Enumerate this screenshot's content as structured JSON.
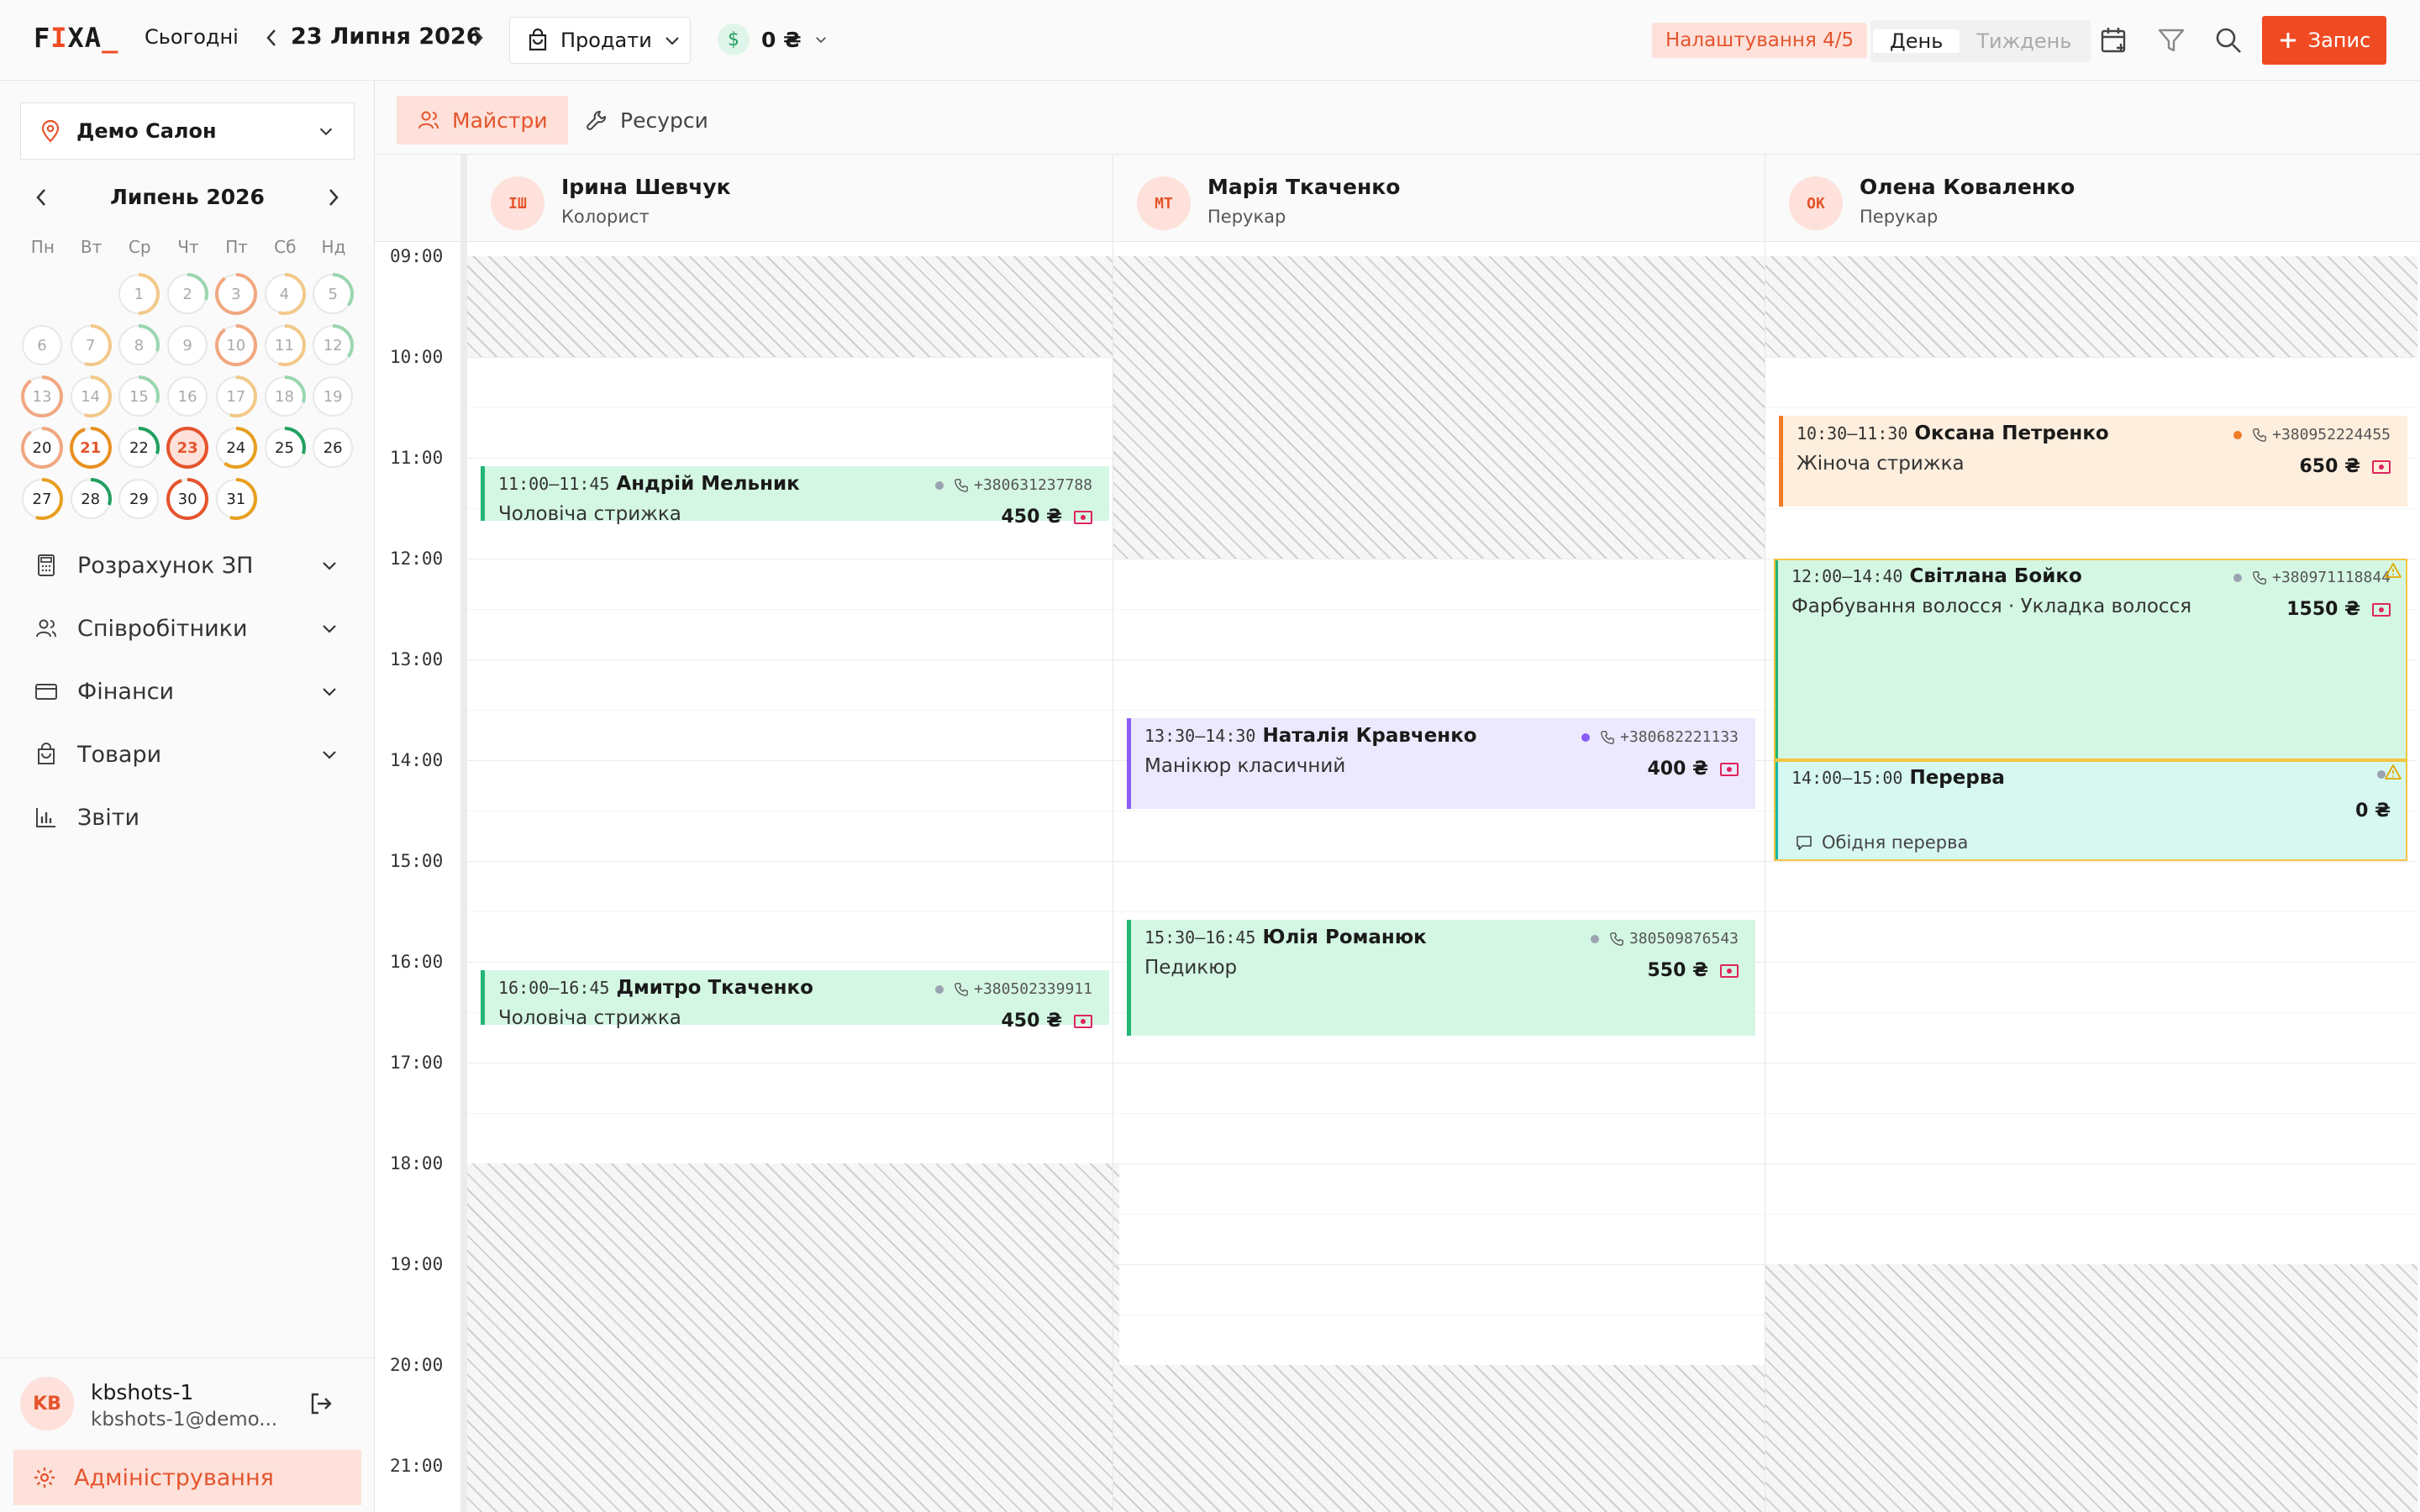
{
  "header": {
    "logo": [
      "F",
      "I",
      "X",
      "A",
      "_"
    ],
    "today_label": "Сьогодні",
    "current_date": "23 Липня 2026",
    "sell_label": "Продати",
    "balance": "0 ₴",
    "setup_badge": "Налаштування 4/5",
    "view_day": "День",
    "view_week": "Тиждень",
    "new_label": "Запис"
  },
  "sidebar": {
    "salon": "Демо Салон",
    "calendar_month": "Липень 2026",
    "weekdays": [
      "Пн",
      "Вт",
      "Ср",
      "Чт",
      "Пт",
      "Сб",
      "Нд"
    ],
    "days": [
      {
        "n": "1",
        "load": 0.5,
        "color": "#f2c98a"
      },
      {
        "n": "2",
        "load": 0.3,
        "color": "#9bd6b0"
      },
      {
        "n": "3",
        "load": 0.9,
        "color": "#f0a882"
      },
      {
        "n": "4",
        "load": 0.55,
        "color": "#f2c98a"
      },
      {
        "n": "5",
        "load": 0.35,
        "color": "#9bd6b0"
      },
      {
        "n": "6",
        "load": 0,
        "color": "#ddd"
      },
      {
        "n": "7",
        "load": 0.55,
        "color": "#f2c98a"
      },
      {
        "n": "8",
        "load": 0.3,
        "color": "#9bd6b0"
      },
      {
        "n": "9",
        "load": 0,
        "color": "#ddd"
      },
      {
        "n": "10",
        "load": 0.9,
        "color": "#f0a882"
      },
      {
        "n": "11",
        "load": 0.55,
        "color": "#f2c98a"
      },
      {
        "n": "12",
        "load": 0.35,
        "color": "#9bd6b0"
      },
      {
        "n": "13",
        "load": 0.9,
        "color": "#f0a882"
      },
      {
        "n": "14",
        "load": 0.55,
        "color": "#f2c98a"
      },
      {
        "n": "15",
        "load": 0.3,
        "color": "#9bd6b0"
      },
      {
        "n": "16",
        "load": 0,
        "color": "#ddd"
      },
      {
        "n": "17",
        "load": 0.55,
        "color": "#f2c98a"
      },
      {
        "n": "18",
        "load": 0.3,
        "color": "#9bd6b0"
      },
      {
        "n": "19",
        "load": 0,
        "color": "#ddd"
      },
      {
        "n": "20",
        "load": 0.9,
        "color": "#f0a882"
      },
      {
        "n": "21",
        "load": 0.95,
        "color": "#e89020"
      },
      {
        "n": "22",
        "load": 0.3,
        "color": "#22a060"
      },
      {
        "n": "23",
        "load": 1.0,
        "color": "#e5542d"
      },
      {
        "n": "24",
        "load": 0.6,
        "color": "#e8a020"
      },
      {
        "n": "25",
        "load": 0.3,
        "color": "#22a060"
      },
      {
        "n": "26",
        "load": 0,
        "color": "#ddd"
      },
      {
        "n": "27",
        "load": 0.55,
        "color": "#e8a020"
      },
      {
        "n": "28",
        "load": 0.3,
        "color": "#22a060"
      },
      {
        "n": "29",
        "load": 0,
        "color": "#ddd"
      },
      {
        "n": "30",
        "load": 0.95,
        "color": "#e5542d"
      },
      {
        "n": "31",
        "load": 0.55,
        "color": "#e8a020"
      }
    ],
    "nav": [
      {
        "label": "Розрахунок ЗП",
        "icon": "calculator-icon",
        "chev": true
      },
      {
        "label": "Співробітники",
        "icon": "users-icon",
        "chev": true
      },
      {
        "label": "Фінанси",
        "icon": "card-icon",
        "chev": true
      },
      {
        "label": "Товари",
        "icon": "bag-icon",
        "chev": true
      },
      {
        "label": "Звіти",
        "icon": "chart-icon",
        "chev": false
      }
    ],
    "user": {
      "initials": "KB",
      "name": "kbshots-1",
      "email": "kbshots-1@demo..."
    },
    "admin_label": "Адміністрування"
  },
  "tabs": [
    {
      "label": "Майстри",
      "active": true
    },
    {
      "label": "Ресурси",
      "active": false
    }
  ],
  "hours": [
    "09:00",
    "10:00",
    "11:00",
    "12:00",
    "13:00",
    "14:00",
    "15:00",
    "16:00",
    "17:00",
    "18:00",
    "19:00",
    "20:00",
    "21:00"
  ],
  "staff": [
    {
      "initials": "ІШ",
      "name": "Ірина Шевчук",
      "role": "Колорист",
      "off": [
        [
          9.0,
          10.0
        ],
        [
          18.0,
          22.0
        ]
      ],
      "appointments": [
        {
          "start": 11.0,
          "end": 11.75,
          "time": "11:00–11:45",
          "client": "Андрій Мельник",
          "phone": "+380631237788",
          "service": "Чоловіча стрижка",
          "price": "450 ₴",
          "bg": "#d4f7e4",
          "border": "#22b573",
          "dot": "#9aa3b0"
        },
        {
          "start": 16.0,
          "end": 16.75,
          "time": "16:00–16:45",
          "client": "Дмитро Ткаченко",
          "phone": "+380502339911",
          "service": "Чоловіча стрижка",
          "price": "450 ₴",
          "bg": "#d4f7e4",
          "border": "#22b573",
          "dot": "#9aa3b0"
        }
      ]
    },
    {
      "initials": "МТ",
      "name": "Марія Ткаченко",
      "role": "Перукар",
      "off": [
        [
          9.0,
          12.0
        ],
        [
          20.0,
          22.0
        ]
      ],
      "appointments": [
        {
          "start": 13.5,
          "end": 14.5,
          "time": "13:30–14:30",
          "client": "Наталія Кравченко",
          "phone": "+380682221133",
          "service": "Манікюр класичний",
          "price": "400 ₴",
          "bg": "#ece9fe",
          "border": "#8b5cf6",
          "dot": "#8b5cf6"
        },
        {
          "start": 15.5,
          "end": 16.75,
          "time": "15:30–16:45",
          "client": "Юлія Романюк",
          "phone": "380509876543",
          "service": "Педикюр",
          "price": "550 ₴",
          "bg": "#d4f7e4",
          "border": "#22b573",
          "dot": "#9aa3b0"
        }
      ]
    },
    {
      "initials": "ОК",
      "name": "Олена Коваленко",
      "role": "Перукар",
      "off": [
        [
          9.0,
          10.0
        ],
        [
          19.0,
          22.0
        ]
      ],
      "appointments": [
        {
          "start": 10.5,
          "end": 11.5,
          "time": "10:30–11:30",
          "client": "Оксана Петренко",
          "phone": "+380952224455",
          "service": "Жіноча стрижка",
          "price": "650 ₴",
          "bg": "#feeedd",
          "border": "#f07c28",
          "dot": "#f07c28"
        },
        {
          "start": 12.0,
          "end": 14.0,
          "time": "12:00–14:40",
          "client": "Світлана Бойко",
          "phone": "+380971118844",
          "service": "Фарбування волосся · Укладка волосся",
          "price": "1550 ₴",
          "bg": "#d4f7e4",
          "border": "#22b573",
          "dot": "#9aa3b0",
          "warn": true
        },
        {
          "start": 14.0,
          "end": 15.0,
          "time": "14:00–15:00",
          "client": "Перерва",
          "phone": "",
          "service": "",
          "price": "0 ₴",
          "bg": "#d6f8f0",
          "border": "#14b8a6",
          "dot": "#9aa3b0",
          "warn": true,
          "note": "Обідня перерва"
        }
      ]
    }
  ]
}
